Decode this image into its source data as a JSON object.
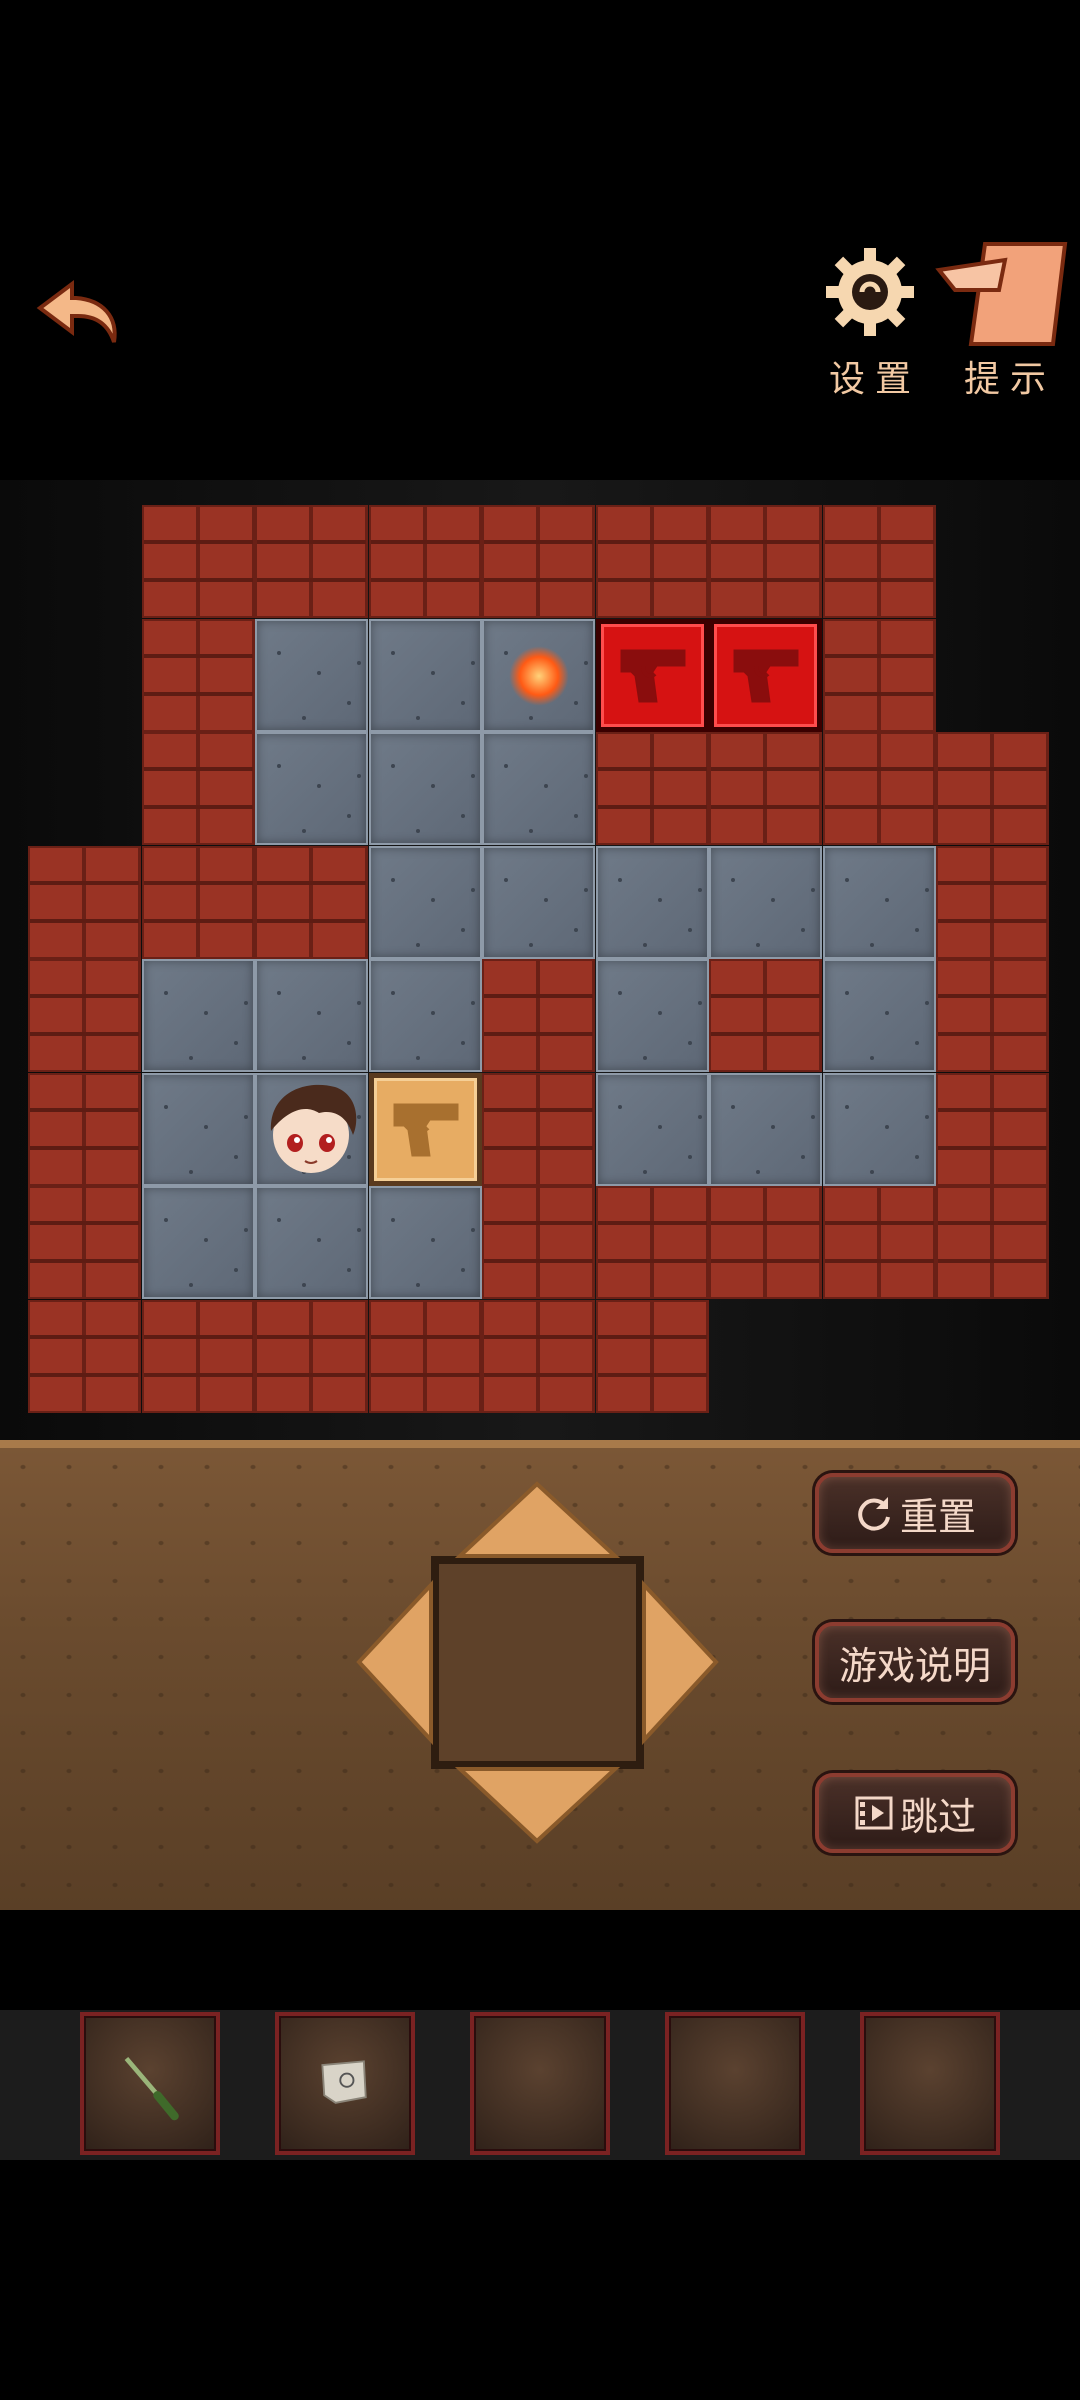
{
  "header": {
    "settings_label": "设置",
    "hint_label": "提示",
    "icons": {
      "back": "back-arrow-icon",
      "settings": "gear-icon",
      "hint": "hint-card-icon"
    }
  },
  "board": {
    "items": {
      "player": "player-boy-icon",
      "goal": "glowing-target-icon",
      "box": "pistol-crate-icon",
      "placed_box": "pistol-crate-on-target-icon"
    }
  },
  "controls": {
    "reset_label": "重置",
    "rules_label": "游戏说明",
    "skip_label": "跳过",
    "icons": {
      "reset": "refresh-icon",
      "skip": "film-skip-icon",
      "dpad": "direction-pad-icon"
    }
  },
  "inventory": {
    "slots": [
      {
        "item": "knife-icon"
      },
      {
        "item": "paper-note-icon"
      },
      {
        "item": ""
      },
      {
        "item": ""
      },
      {
        "item": ""
      }
    ]
  },
  "colors": {
    "brick": "#9a3324",
    "floor": "#6f7a88",
    "target_crate": "#d61212",
    "crate": "#e7ac63",
    "label": "#f2c9a3"
  }
}
